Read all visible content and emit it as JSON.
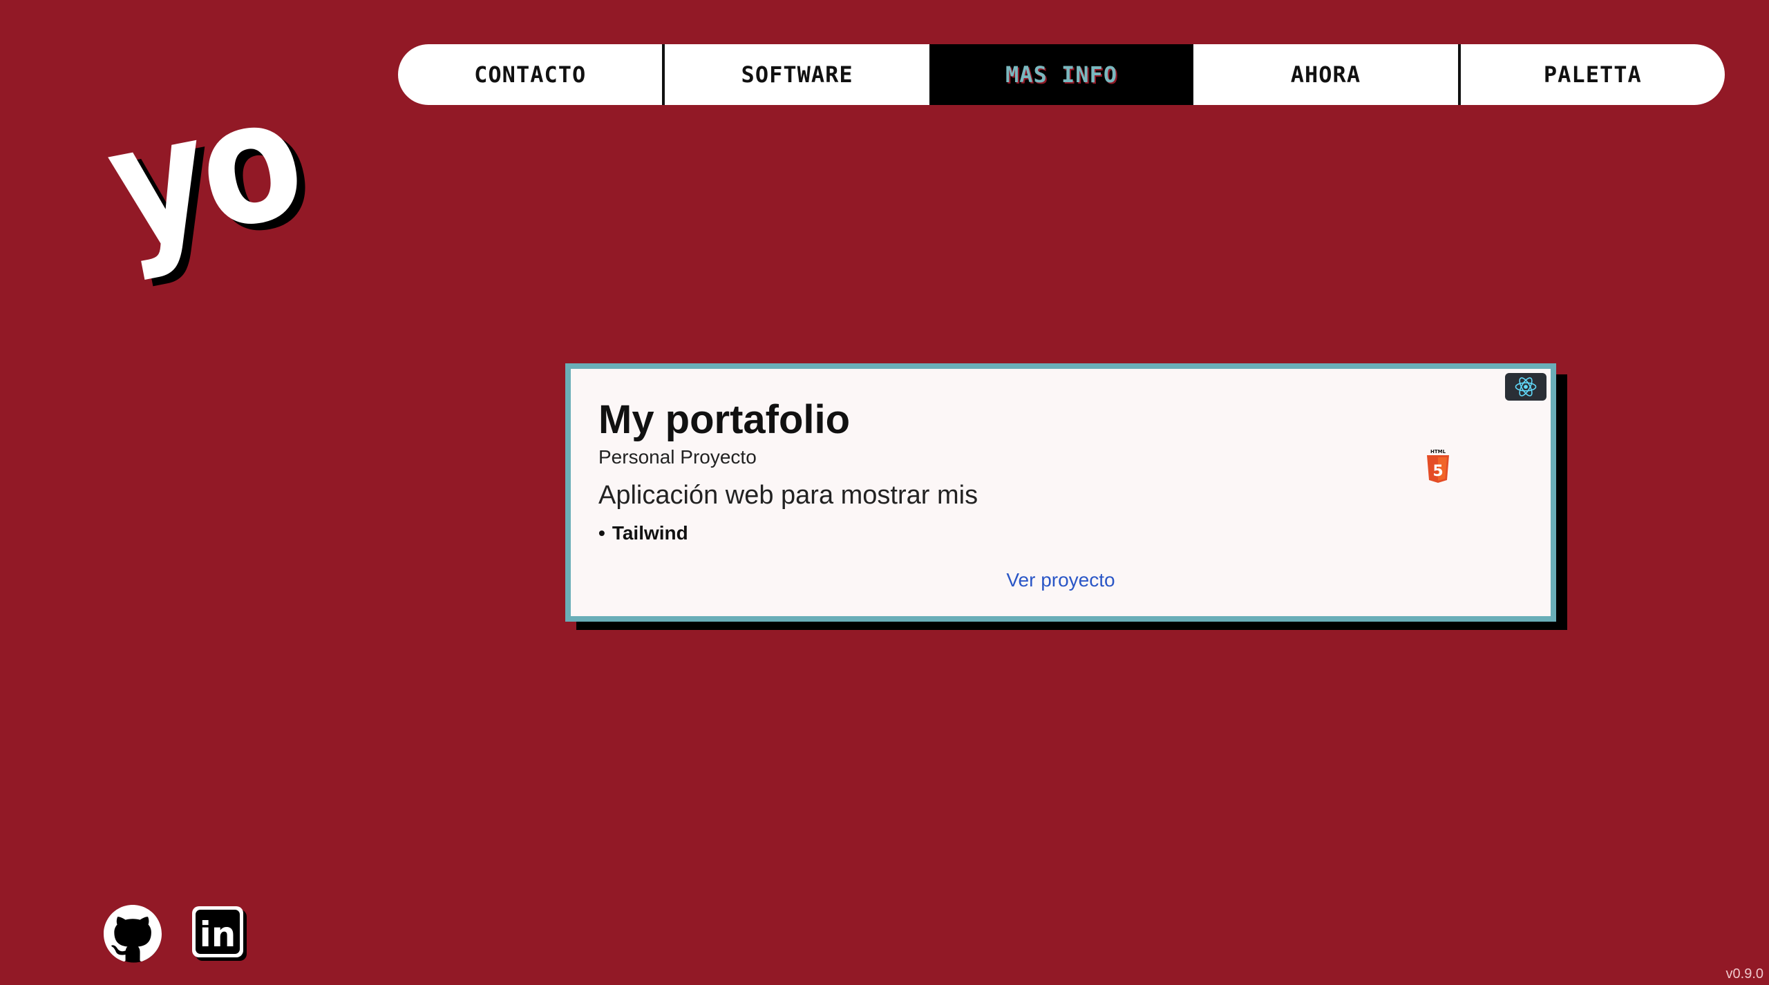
{
  "nav": {
    "items": [
      {
        "label": "CONTACTO"
      },
      {
        "label": "SOFTWARE"
      },
      {
        "label": "MAS INFO"
      },
      {
        "label": "AHORA"
      },
      {
        "label": "PALETTA"
      }
    ],
    "active": "MAS INFO"
  },
  "logo": {
    "text": "yo"
  },
  "project": {
    "title": "My portafolio",
    "subtitle": "Personal Proyecto",
    "description": "Aplicación web para mostrar mis",
    "tech_bullet": "•",
    "tech": "Tailwind",
    "link_label": "Ver proyecto",
    "icons": [
      "react-icon",
      "html5-icon"
    ],
    "html5_badge_text": "HTML",
    "html5_badge_number": "5"
  },
  "social": {
    "icons": [
      "github-icon",
      "linkedin-icon"
    ],
    "linkedin_text": "in"
  },
  "version": "v0.9.0",
  "colors": {
    "background": "#921926",
    "card_border": "#6aaeb8",
    "card_background": "#fcf7f7",
    "active_nav_text": "#7ab8bf",
    "link": "#2a56c6",
    "react_accent": "#61dafb",
    "html5_orange": "#e44d26"
  }
}
